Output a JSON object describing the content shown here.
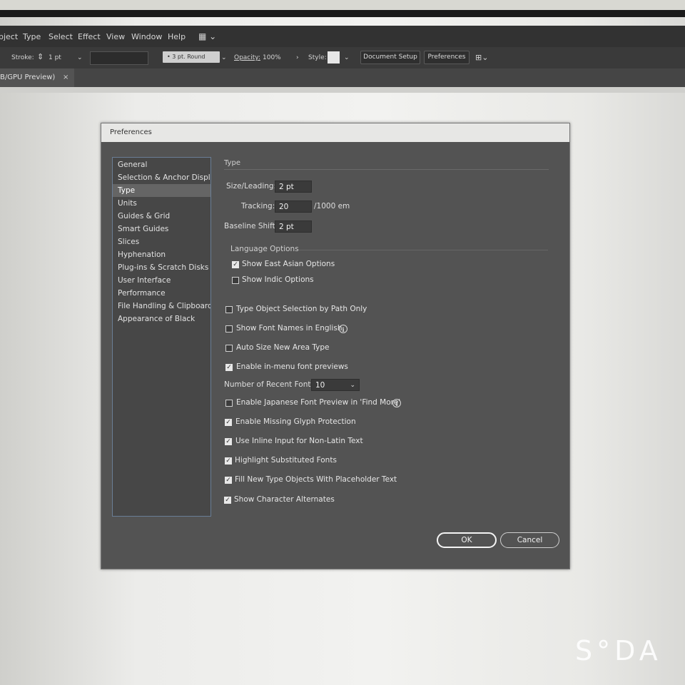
{
  "menubar": {
    "items": [
      "bject",
      "Type",
      "Select",
      "Effect",
      "View",
      "Window",
      "Help"
    ]
  },
  "controlbar": {
    "stroke_label": "Stroke:",
    "stroke_value": "1 pt",
    "brush_value": "3 pt. Round",
    "opacity_label": "Opacity:",
    "opacity_value": "100%",
    "style_label": "Style:",
    "document_setup": "Document Setup",
    "preferences": "Preferences"
  },
  "tab": {
    "label": "B/GPU Preview)",
    "close": "×"
  },
  "dialog": {
    "title": "Preferences",
    "sidebar": [
      "General",
      "Selection & Anchor Display",
      "Type",
      "Units",
      "Guides & Grid",
      "Smart Guides",
      "Slices",
      "Hyphenation",
      "Plug-ins & Scratch Disks",
      "User Interface",
      "Performance",
      "File Handling & Clipboard",
      "Appearance of Black"
    ],
    "selected": "Type",
    "section_title": "Type",
    "size_leading_label": "Size/Leading:",
    "size_leading_value": "2 pt",
    "tracking_label": "Tracking:",
    "tracking_value": "20",
    "tracking_unit": "/1000 em",
    "baseline_label": "Baseline Shift:",
    "baseline_value": "2 pt",
    "language_options_title": "Language Options",
    "show_east_asian": {
      "label": "Show East Asian Options",
      "checked": true
    },
    "show_indic": {
      "label": "Show Indic Options",
      "checked": false
    },
    "type_object_selection": {
      "label": "Type Object Selection by Path Only",
      "checked": false
    },
    "show_font_names_english": {
      "label": "Show Font Names in English",
      "checked": false
    },
    "auto_size_area_type": {
      "label": "Auto Size New Area Type",
      "checked": false
    },
    "enable_menu_font_previews": {
      "label": "Enable in-menu font previews",
      "checked": true
    },
    "recent_fonts_label": "Number of Recent Fonts:",
    "recent_fonts_value": "10",
    "enable_japanese_preview": {
      "label": "Enable Japanese Font Preview in 'Find More'",
      "checked": false
    },
    "missing_glyph_protection": {
      "label": "Enable Missing Glyph Protection",
      "checked": true
    },
    "inline_input": {
      "label": "Use Inline Input for Non-Latin Text",
      "checked": true
    },
    "highlight_substituted": {
      "label": "Highlight Substituted Fonts",
      "checked": true
    },
    "placeholder_text": {
      "label": "Fill New Type Objects With Placeholder Text",
      "checked": true
    },
    "character_alternates": {
      "label": "Show Character Alternates",
      "checked": true
    },
    "ok": "OK",
    "cancel": "Cancel"
  },
  "watermark": "S°DA",
  "colors": {
    "dialog_bg": "#535353",
    "sidebar_bg": "#474747",
    "selection": "#656565",
    "menubar": "#323232"
  }
}
